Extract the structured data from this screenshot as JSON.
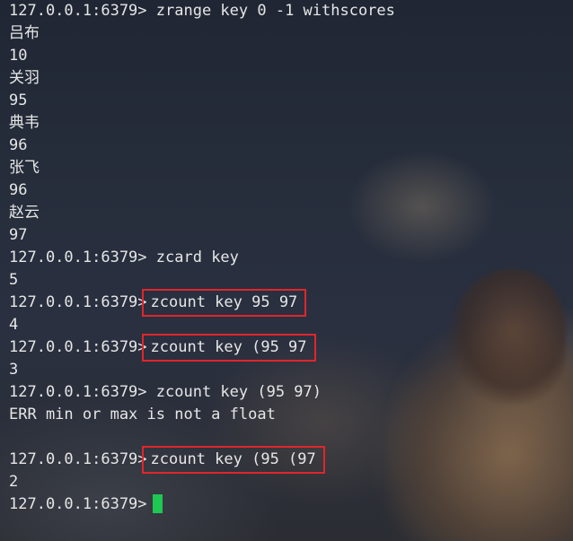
{
  "terminal": {
    "prompt": "127.0.0.1:6379>",
    "colors": {
      "text": "#e6e6e6",
      "highlight_box": "#e0262b",
      "cursor": "#1ec853"
    },
    "lines": [
      {
        "prompt": true,
        "command": "zrange key 0 -1 withscores",
        "boxed": false
      },
      {
        "text": "吕布"
      },
      {
        "text": "10"
      },
      {
        "text": "关羽"
      },
      {
        "text": "95"
      },
      {
        "text": "典韦"
      },
      {
        "text": "96"
      },
      {
        "text": "张飞"
      },
      {
        "text": "96"
      },
      {
        "text": "赵云"
      },
      {
        "text": "97"
      },
      {
        "prompt": true,
        "command": "zcard key",
        "boxed": false
      },
      {
        "text": "5"
      },
      {
        "prompt": true,
        "command": "zcount key 95 97",
        "boxed": true
      },
      {
        "text": "4"
      },
      {
        "prompt": true,
        "command": "zcount key (95 97",
        "boxed": true
      },
      {
        "text": "3"
      },
      {
        "prompt": true,
        "command": "zcount key (95 97)",
        "boxed": false
      },
      {
        "text": "ERR min or max is not a float"
      },
      {
        "text": ""
      },
      {
        "prompt": true,
        "command": "zcount key (95 (97",
        "boxed": true
      },
      {
        "text": "2"
      },
      {
        "prompt": true,
        "command": "",
        "boxed": false,
        "cursor": true
      }
    ]
  }
}
